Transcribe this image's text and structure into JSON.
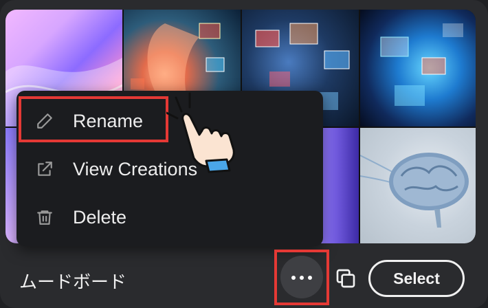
{
  "menu": {
    "items": [
      {
        "label": "Rename",
        "icon": "pencil-icon"
      },
      {
        "label": "View Creations",
        "icon": "external-link-icon"
      },
      {
        "label": "Delete",
        "icon": "trash-icon"
      }
    ]
  },
  "board": {
    "title": "ムードボード",
    "select_label": "Select",
    "more_icon": "more-horizontal-icon",
    "copy_icon": "copy-icon"
  },
  "colors": {
    "highlight": "#e53935",
    "menu_bg": "#1b1c1f",
    "card_bg": "#2a2b2e"
  }
}
